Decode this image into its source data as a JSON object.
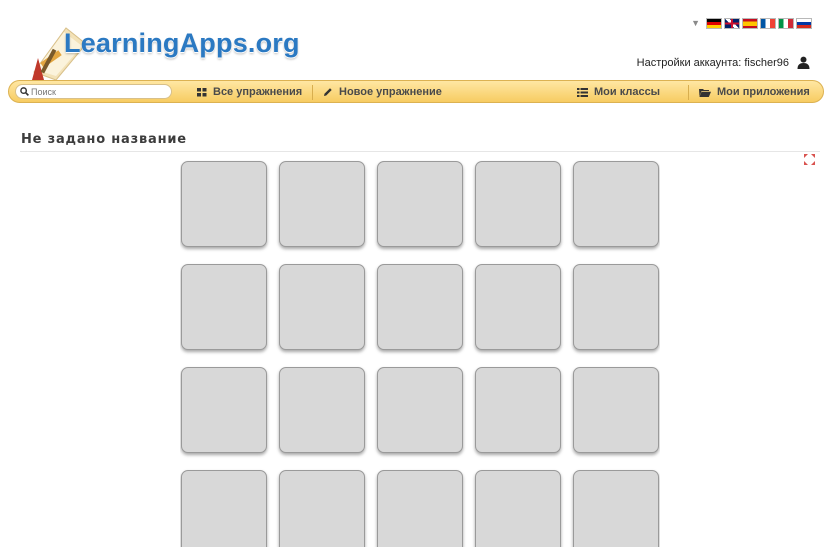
{
  "header": {
    "logo_text": "LearningApps.org",
    "account_label": "Настройки аккаунта: fischer96"
  },
  "languages": [
    {
      "code": "de",
      "colors": [
        "#000000",
        "#dd0000",
        "#ffce00"
      ]
    },
    {
      "code": "en",
      "colors": [
        "#012169",
        "#ffffff",
        "#c8102e"
      ]
    },
    {
      "code": "es",
      "colors": [
        "#c60b1e",
        "#ffc400",
        "#c60b1e"
      ]
    },
    {
      "code": "fr",
      "colors": [
        "#0055a4",
        "#ffffff",
        "#ef4135"
      ]
    },
    {
      "code": "it",
      "colors": [
        "#009246",
        "#ffffff",
        "#ce2b37"
      ]
    },
    {
      "code": "ru",
      "colors": [
        "#ffffff",
        "#0039a6",
        "#d52b1e"
      ]
    }
  ],
  "nav": {
    "search_placeholder": "Поиск",
    "all_exercises": "Все упражнения",
    "new_exercise": "Новое упражнение",
    "my_classes": "Мои классы",
    "my_apps": "Мои приложения"
  },
  "page": {
    "title": "Не задано название"
  },
  "grid": {
    "columns": 5,
    "visible_rows": 4,
    "card_color": "#d8d8d8"
  },
  "colors": {
    "accent_blue": "#2b79c2",
    "nav_bar": "#f7cc62"
  }
}
